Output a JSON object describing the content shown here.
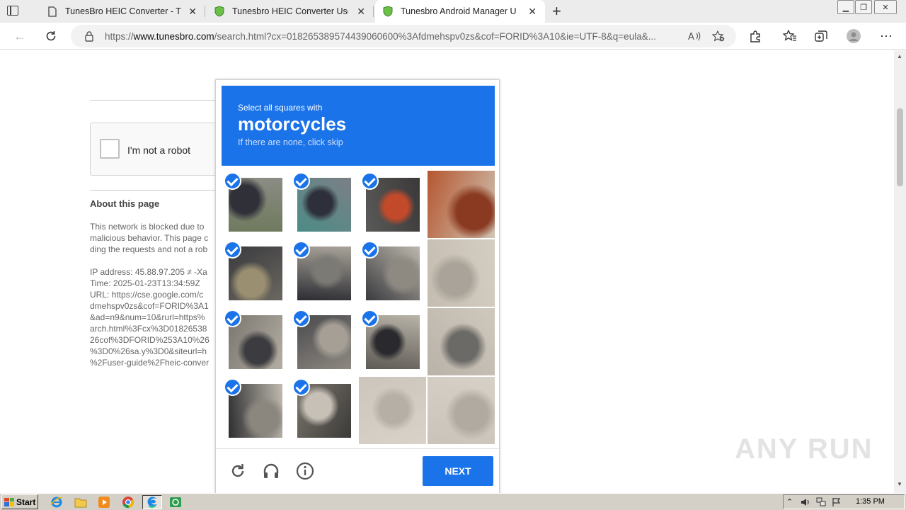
{
  "browser": {
    "tabs": [
      {
        "title": "TunesBro HEIC Converter - The",
        "active": false,
        "icon": "document-icon"
      },
      {
        "title": "Tunesbro HEIC Converter User G",
        "active": false,
        "icon": "shield-favicon-icon"
      },
      {
        "title": "Tunesbro Android Manager Use",
        "active": true,
        "icon": "shield-favicon-icon"
      }
    ],
    "address": {
      "prefix": "https://",
      "domain": "www.tunesbro.com",
      "path": "/search.html?cx=018265389574439060600%3Afdmehspv0zs&cof=FORID%3A10&ie=UTF-8&q=eula&..."
    }
  },
  "page": {
    "recaptcha_label": "I'm not a robot",
    "about_heading": "About this page",
    "block_text": [
      "This network is blocked due to",
      "malicious behavior. This page c",
      "ding the requests and not a rob"
    ],
    "details": [
      "IP address: 45.88.97.205 ≠ -Xa",
      "Time: 2025-01-23T13:34:59Z",
      "URL: https://cse.google.com/c",
      "dmehspv0zs&cof=FORID%3A1",
      "&ad=n9&num=10&rurl=https%",
      "arch.html%3Fcx%3D01826538",
      "26cof%3DFORID%253A10%26",
      "%3D0%26sa.y%3D0&siteurl=h",
      "%2Fuser-guide%2Fheic-conver"
    ]
  },
  "challenge": {
    "instruction": "Select all squares with",
    "target": "motorcycles",
    "hint": "If there are none, click skip",
    "tiles": [
      {
        "selected": true
      },
      {
        "selected": true
      },
      {
        "selected": true
      },
      {
        "selected": false
      },
      {
        "selected": true
      },
      {
        "selected": true
      },
      {
        "selected": true
      },
      {
        "selected": false
      },
      {
        "selected": true
      },
      {
        "selected": true
      },
      {
        "selected": true
      },
      {
        "selected": false
      },
      {
        "selected": true
      },
      {
        "selected": true
      },
      {
        "selected": false
      },
      {
        "selected": false
      }
    ],
    "next_label": "NEXT"
  },
  "watermark": "ANY RUN",
  "taskbar": {
    "start_label": "Start",
    "clock": "1:35 PM"
  },
  "colors": {
    "accent": "#1a73e8",
    "taskbar": "#d4d0c8"
  }
}
